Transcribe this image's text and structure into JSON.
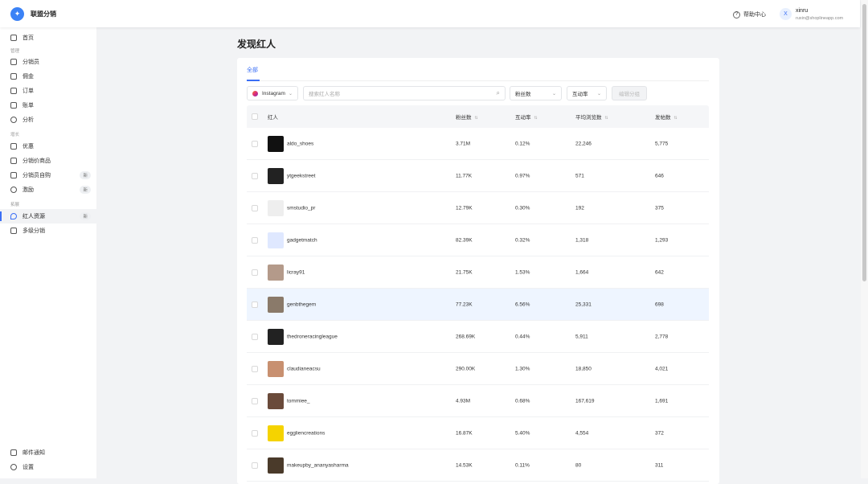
{
  "header": {
    "brand": "联盟分销",
    "help": "帮助中心",
    "user_initial": "X",
    "user_name": "xinru",
    "user_email": "ruxin@shoplineapp.com"
  },
  "sidebar": {
    "home": "首页",
    "groups": [
      "管理",
      "增长",
      "拓展"
    ],
    "items": [
      {
        "label": "分销员"
      },
      {
        "label": "佣金"
      },
      {
        "label": "订单"
      },
      {
        "label": "账单"
      },
      {
        "label": "分析"
      },
      {
        "label": "优惠"
      },
      {
        "label": "分销价商品"
      },
      {
        "label": "分销员自购",
        "badge": "新"
      },
      {
        "label": "激励",
        "badge": "新"
      },
      {
        "label": "红人资源",
        "badge": "新"
      },
      {
        "label": "多级分销"
      }
    ],
    "bottom": [
      "邮件通知",
      "设置"
    ]
  },
  "page": {
    "title": "发现红人",
    "tab": "全部"
  },
  "filters": {
    "platform": "Instagram",
    "search_placeholder": "搜索红人名称",
    "fans": "粉丝数",
    "rate": "互动率",
    "edit_group": "编辑分组"
  },
  "table": {
    "headers": [
      "红人",
      "粉丝数",
      "互动率",
      "平均浏览数",
      "发帖数"
    ],
    "rows": [
      {
        "name": "aldo_shoes",
        "fans": "3.71M",
        "rate": "0.12%",
        "views": "22,246",
        "posts": "5,775",
        "color": "#111"
      },
      {
        "name": "ytgeekstreet",
        "fans": "11.77K",
        "rate": "0.97%",
        "views": "571",
        "posts": "646",
        "color": "#222"
      },
      {
        "name": "smstudio_pr",
        "fans": "12.79K",
        "rate": "0.30%",
        "views": "192",
        "posts": "375",
        "color": "#eee"
      },
      {
        "name": "gadgetmatch",
        "fans": "82.39K",
        "rate": "0.32%",
        "views": "1,318",
        "posts": "1,293",
        "color": "#dfe8ff"
      },
      {
        "name": "licray91",
        "fans": "21.75K",
        "rate": "1.53%",
        "views": "1,664",
        "posts": "642",
        "color": "#b49a8a"
      },
      {
        "name": "genbthegem",
        "fans": "77.23K",
        "rate": "6.56%",
        "views": "25,331",
        "posts": "698",
        "color": "#8a7a6a"
      },
      {
        "name": "thedroneracingleague",
        "fans": "268.69K",
        "rate": "0.44%",
        "views": "5,911",
        "posts": "2,778",
        "color": "#222"
      },
      {
        "name": "claudianeacsu",
        "fans": "290.00K",
        "rate": "1.30%",
        "views": "18,850",
        "posts": "4,021",
        "color": "#c89070"
      },
      {
        "name": "tommiee_",
        "fans": "4.93M",
        "rate": "0.68%",
        "views": "167,619",
        "posts": "1,691",
        "color": "#6a4a3a"
      },
      {
        "name": "eggliencreations",
        "fans": "16.87K",
        "rate": "5.40%",
        "views": "4,554",
        "posts": "372",
        "color": "#f5d300"
      },
      {
        "name": "makeupby_ananyasharma",
        "fans": "14.53K",
        "rate": "0.11%",
        "views": "80",
        "posts": "311",
        "color": "#4a3a2a"
      }
    ]
  }
}
